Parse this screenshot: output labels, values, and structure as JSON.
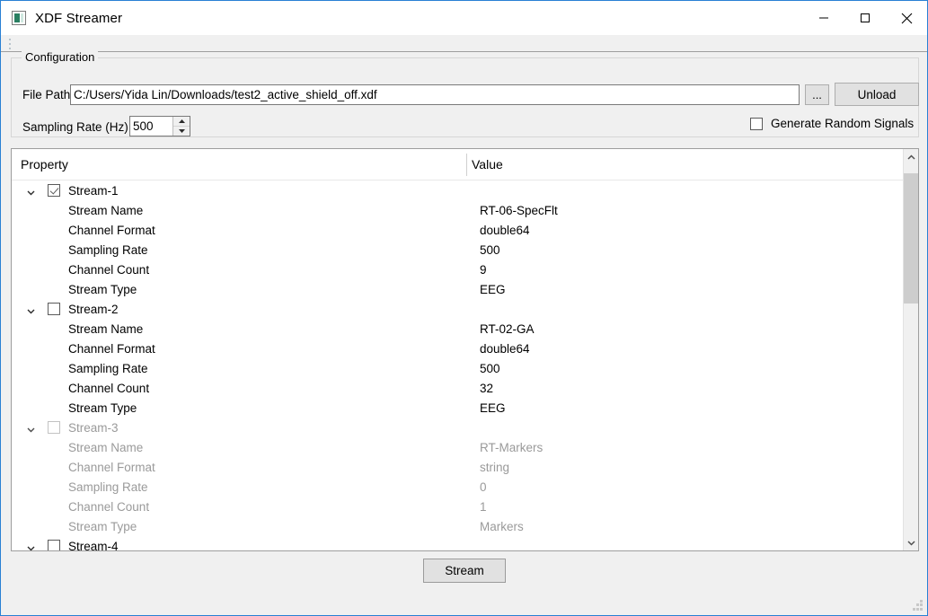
{
  "window": {
    "title": "XDF Streamer",
    "icon": "app-icon",
    "minimize_label": "Minimize",
    "maximize_label": "Maximize",
    "close_label": "Close"
  },
  "config": {
    "legend": "Configuration",
    "file_path_label": "File Path",
    "file_path_value": "C:/Users/Yida Lin/Downloads/test2_active_shield_off.xdf",
    "file_path_placeholder": "",
    "browse_label": "...",
    "unload_label": "Unload",
    "sampling_rate_label": "Sampling Rate (Hz)",
    "sampling_rate_value": "500",
    "generate_random_label": "Generate Random Signals",
    "generate_random_checked": false
  },
  "tree": {
    "header": {
      "property": "Property",
      "value": "Value"
    },
    "rows": [
      {
        "type": "group",
        "label": "Stream-1",
        "value": "",
        "checked": true,
        "expanded": true,
        "disabled": false
      },
      {
        "type": "child",
        "label": "Stream Name",
        "value": "RT-06-SpecFlt",
        "disabled": false
      },
      {
        "type": "child",
        "label": "Channel Format",
        "value": "double64",
        "disabled": false
      },
      {
        "type": "child",
        "label": "Sampling Rate",
        "value": "500",
        "disabled": false
      },
      {
        "type": "child",
        "label": "Channel Count",
        "value": "9",
        "disabled": false
      },
      {
        "type": "child",
        "label": "Stream Type",
        "value": "EEG",
        "disabled": false
      },
      {
        "type": "group",
        "label": "Stream-2",
        "value": "",
        "checked": false,
        "expanded": true,
        "disabled": false
      },
      {
        "type": "child",
        "label": "Stream Name",
        "value": "RT-02-GA",
        "disabled": false
      },
      {
        "type": "child",
        "label": "Channel Format",
        "value": "double64",
        "disabled": false
      },
      {
        "type": "child",
        "label": "Sampling Rate",
        "value": "500",
        "disabled": false
      },
      {
        "type": "child",
        "label": "Channel Count",
        "value": "32",
        "disabled": false
      },
      {
        "type": "child",
        "label": "Stream Type",
        "value": "EEG",
        "disabled": false
      },
      {
        "type": "group",
        "label": "Stream-3",
        "value": "",
        "checked": false,
        "expanded": true,
        "disabled": true
      },
      {
        "type": "child",
        "label": "Stream Name",
        "value": "RT-Markers",
        "disabled": true
      },
      {
        "type": "child",
        "label": "Channel Format",
        "value": "string",
        "disabled": true
      },
      {
        "type": "child",
        "label": "Sampling Rate",
        "value": "0",
        "disabled": true
      },
      {
        "type": "child",
        "label": "Channel Count",
        "value": "1",
        "disabled": true
      },
      {
        "type": "child",
        "label": "Stream Type",
        "value": "Markers",
        "disabled": true
      },
      {
        "type": "group",
        "label": "Stream-4",
        "value": "",
        "checked": false,
        "expanded": true,
        "disabled": false
      }
    ]
  },
  "scrollbar": {
    "up_icon": "chevron-up-icon",
    "down_icon": "chevron-down-icon"
  },
  "footer": {
    "stream_label": "Stream"
  },
  "colors": {
    "window_border": "#2980d4",
    "window_bg": "#f0f0f0",
    "panel_bg": "#ffffff",
    "button_bg": "#e1e1e1",
    "scroll_thumb": "#cdcdcd",
    "disabled_text": "#9a9a9a",
    "icon_accent": "#2a7f62"
  }
}
